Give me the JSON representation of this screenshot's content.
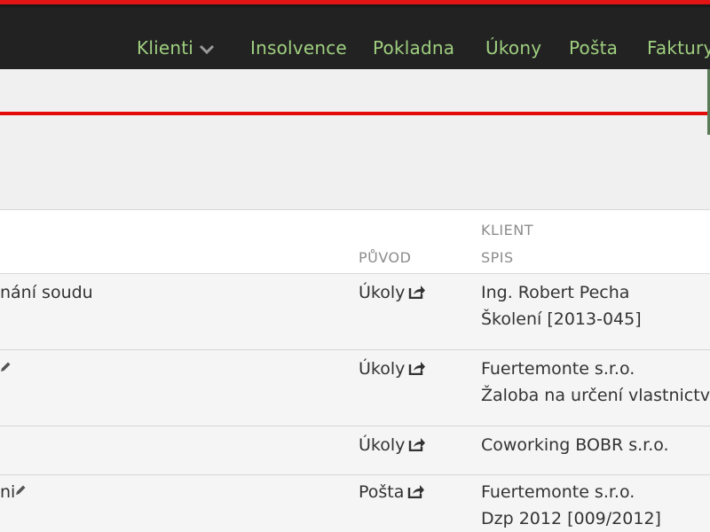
{
  "nav": {
    "items": [
      {
        "label": "Klienti"
      },
      {
        "label": "Insolvence"
      },
      {
        "label": "Pokladna"
      },
      {
        "label": "Úkony"
      },
      {
        "label": "Pošta"
      },
      {
        "label": "Faktury"
      }
    ]
  },
  "table": {
    "headers": {
      "puvod": "PŮVOD",
      "klient": "KLIENT",
      "spis": "SPIS"
    },
    "rows": [
      {
        "desc": "nání soudu",
        "puvod": "Úkoly",
        "klient": "Ing. Robert Pecha",
        "spis": "Školení [2013-045]"
      },
      {
        "desc": "",
        "puvod": "Úkoly",
        "klient": "Fuertemonte s.r.o.",
        "spis": "Žaloba na určení vlastnictví"
      },
      {
        "desc": "",
        "puvod": "Úkoly",
        "klient": "Coworking BOBR s.r.o.",
        "spis": ""
      },
      {
        "desc": "ni",
        "puvod": "Pošta",
        "klient": "Fuertemonte s.r.o.",
        "spis": "Dzp 2012 [009/2012]"
      }
    ]
  },
  "colors": {
    "topbar": "#222222",
    "accent_red": "#e31414",
    "nav_text": "#9fcf7f"
  },
  "icons": [
    "chevron-down-icon",
    "pencil-icon",
    "share-icon"
  ]
}
